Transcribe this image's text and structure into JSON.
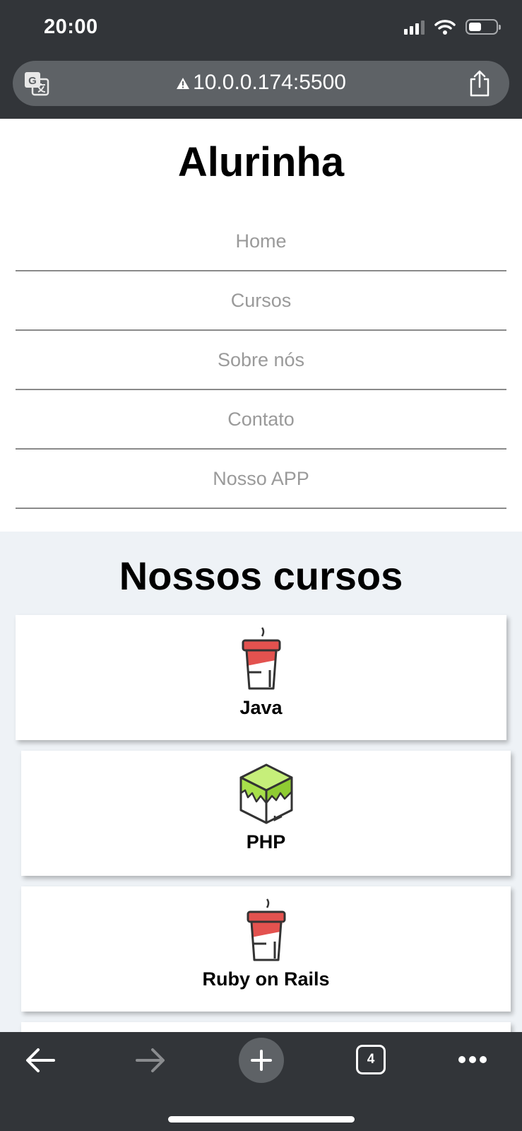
{
  "status_bar": {
    "time": "20:00"
  },
  "browser": {
    "url": "10.0.0.174:5500",
    "tab_count": "4",
    "icons": [
      "translate-icon",
      "warning-icon",
      "share-icon",
      "back-icon",
      "forward-icon",
      "plus-icon",
      "tabs-icon",
      "more-icon"
    ]
  },
  "page": {
    "title": "Alurinha",
    "nav": [
      "Home",
      "Cursos",
      "Sobre nós",
      "Contato",
      "Nosso APP"
    ],
    "courses_title": "Nossos cursos",
    "courses": [
      {
        "label": "Java",
        "icon": "coffee-cup-icon"
      },
      {
        "label": "PHP",
        "icon": "cube-icon"
      },
      {
        "label": "Ruby on Rails",
        "icon": "coffee-cup-icon"
      }
    ]
  },
  "colors": {
    "chrome": "#323539",
    "url_bar": "#5e6266",
    "section_bg": "#eef2f6",
    "cup_red": "#e3524f",
    "cube_green": "#a8e04a"
  }
}
